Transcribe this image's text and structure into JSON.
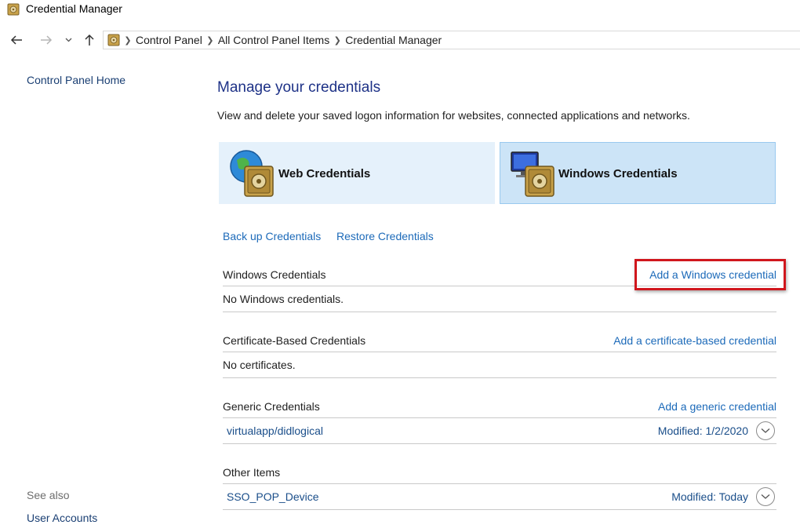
{
  "window": {
    "title": "Credential Manager"
  },
  "address": {
    "crumbs": [
      "Control Panel",
      "All Control Panel Items",
      "Credential Manager"
    ]
  },
  "left_pane": {
    "home_link": "Control Panel Home",
    "see_also": "See also",
    "user_accounts": "User Accounts"
  },
  "main": {
    "title": "Manage your credentials",
    "description": "View and delete your saved logon information for websites, connected applications and networks.",
    "tiles": {
      "web": "Web Credentials",
      "windows": "Windows Credentials"
    },
    "actions": {
      "backup": "Back up Credentials",
      "restore": "Restore Credentials"
    },
    "sections": {
      "windows": {
        "label": "Windows Credentials",
        "add_link": "Add a Windows credential",
        "empty": "No Windows credentials."
      },
      "certificate": {
        "label": "Certificate-Based Credentials",
        "add_link": "Add a certificate-based credential",
        "empty": "No certificates."
      },
      "generic": {
        "label": "Generic Credentials",
        "add_link": "Add a generic credential",
        "items": [
          {
            "name": "virtualapp/didlogical",
            "modified": "Modified:  1/2/2020"
          }
        ]
      },
      "other": {
        "label": "Other Items",
        "items": [
          {
            "name": "SSO_POP_Device",
            "modified": "Modified:  Today"
          }
        ]
      }
    }
  },
  "colors": {
    "link": "#1c6ab9",
    "title": "#1e3287",
    "tile_selected": "#cce4f7",
    "tile_unselected": "#e5f1fb",
    "highlight": "#d0161d"
  },
  "icons": {
    "title": "credential-vault-icon",
    "back": "arrow-left-icon",
    "forward": "arrow-right-icon",
    "recent": "chevron-down-icon",
    "up": "arrow-up-icon",
    "web_tile": "globe-vault-icon",
    "windows_tile": "monitor-vault-icon",
    "expand": "chevron-down-circle-icon"
  }
}
